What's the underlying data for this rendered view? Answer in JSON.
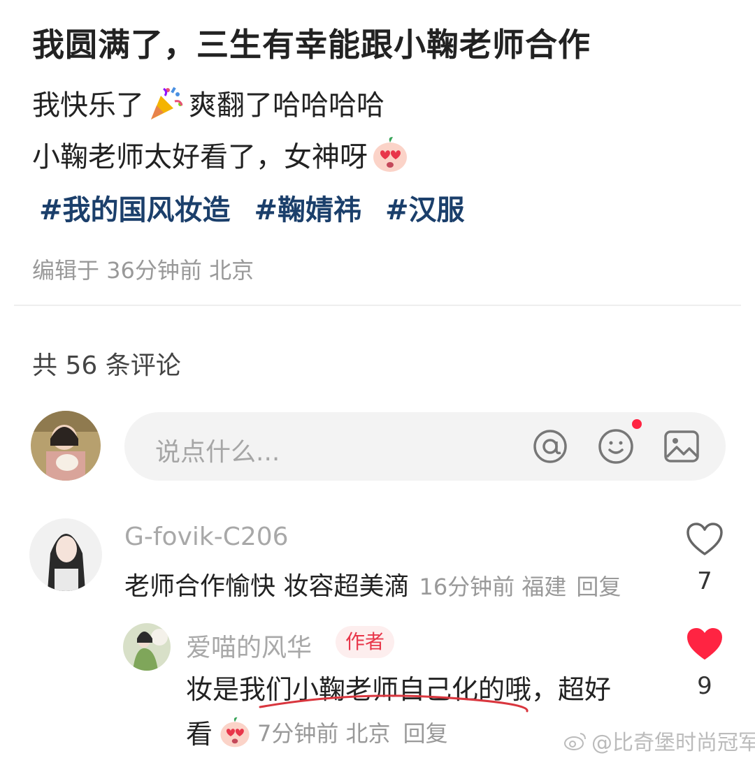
{
  "post": {
    "title": "我圆满了，三生有幸能跟小鞠老师合作",
    "line1_before": "我快乐了",
    "line1_emoji": "party-popper-emoji",
    "line1_after": "爽翻了哈哈哈哈",
    "line2_before": "小鞠老师太好看了，女神呀",
    "line2_emoji": "heart-eyes-emoji",
    "tags": [
      "#我的国风妆造",
      "#鞠婧祎",
      "#汉服"
    ],
    "meta": "编辑于 36分钟前 北京"
  },
  "comments_header": "共 56 条评论",
  "input": {
    "placeholder": "说点什么...",
    "icons": [
      "at-icon",
      "smile-icon",
      "image-icon"
    ]
  },
  "comments": [
    {
      "username": "G-fovik-C206",
      "text": "老师合作愉快 妆容超美滴",
      "time_location": "16分钟前 福建",
      "reply_label": "回复",
      "likes": "7",
      "liked": false
    },
    {
      "username": "爱喵的风华",
      "badge": "作者",
      "text_line1": "妆是我们小鞠老师自己化的哦，超好",
      "text_line2": "看",
      "emoji": "heart-eyes-emoji",
      "time_location": "7分钟前 北京",
      "reply_label": "回复",
      "likes": "9",
      "liked": true
    }
  ],
  "watermark": "@比奇堡时尚冠军",
  "colors": {
    "tag": "#1b3f6b",
    "like_red": "#ff2442",
    "badge_bg": "#fdeeee",
    "badge_text": "#e8364a",
    "muted": "#999999",
    "underline": "#d9363e"
  }
}
